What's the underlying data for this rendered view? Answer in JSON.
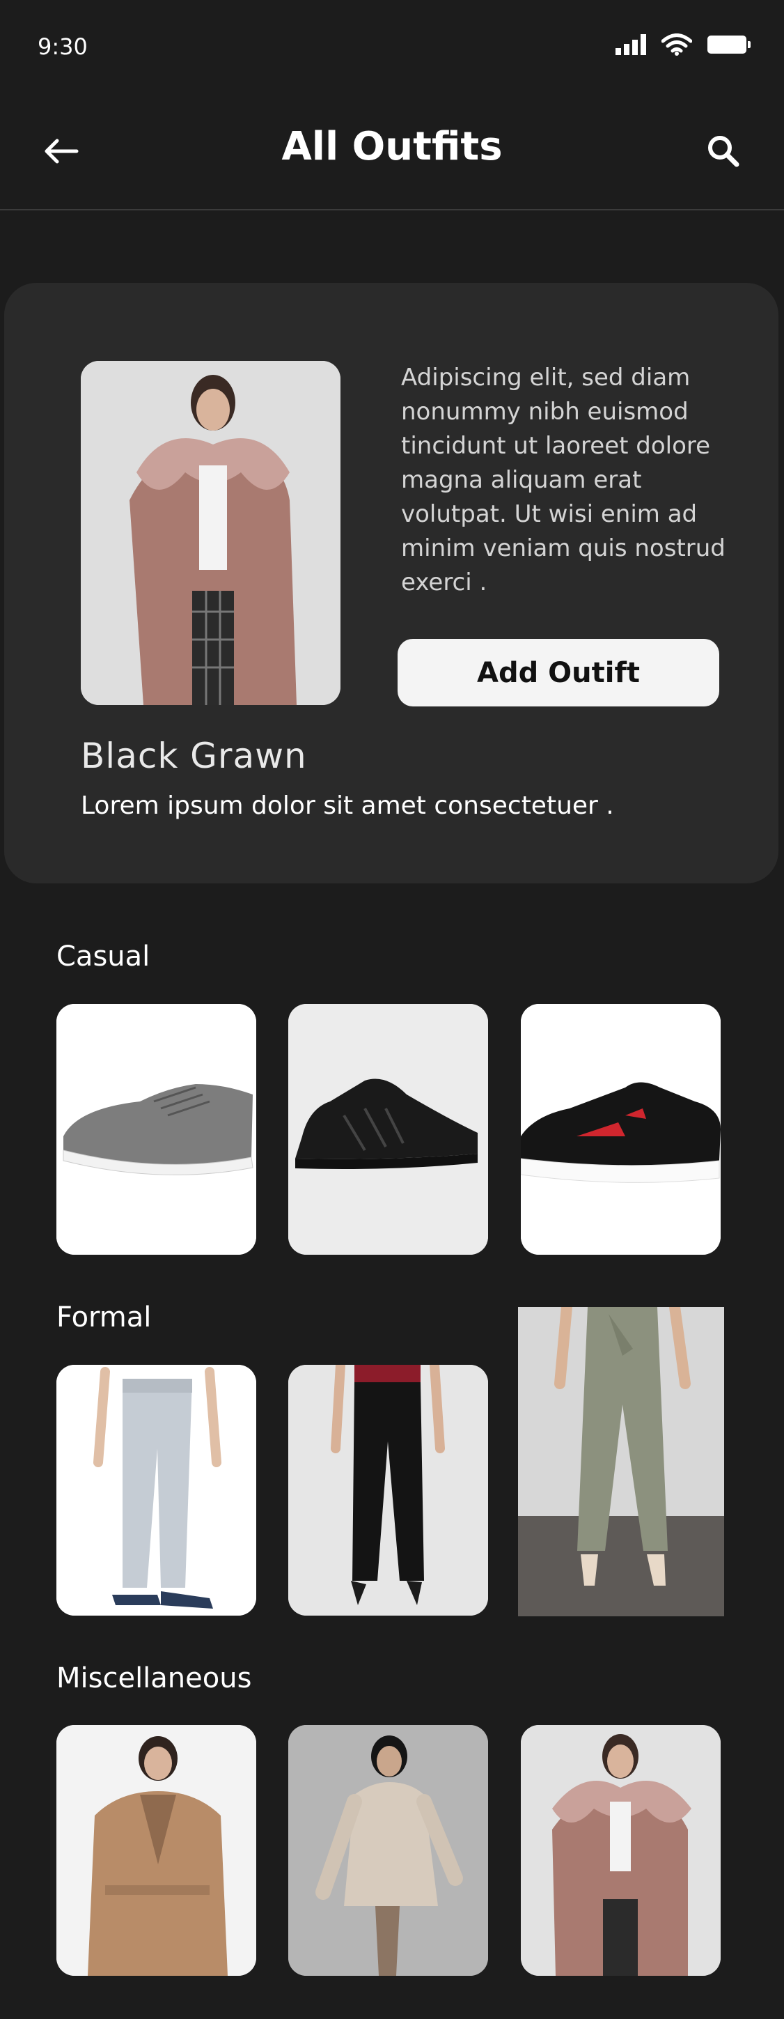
{
  "status_bar": {
    "time": "9:30"
  },
  "header": {
    "title": "All Outfits"
  },
  "hero": {
    "description": "Adipiscing elit, sed diam nonummy nibh euismod tincidunt ut laoreet dolore magna aliquam erat volutpat. Ut wisi enim ad minim veniam quis nostrud exerci  .",
    "add_button_label": "Add Outift",
    "name": "Black Grawn",
    "subtitle": "Lorem ipsum dolor sit amet consectetuer ."
  },
  "sections": [
    {
      "title": "Casual",
      "items": [
        "grey-sneaker",
        "black-knit-sneaker",
        "black-red-sneaker"
      ]
    },
    {
      "title": "Formal",
      "items": [
        "grey-joggers",
        "black-trousers",
        "olive-pants"
      ]
    },
    {
      "title": "Miscellaneous",
      "items": [
        "camel-coat",
        "beige-trench",
        "pink-puffer"
      ]
    }
  ],
  "colors": {
    "background": "#1c1c1c",
    "card": "#2a2a2a",
    "button": "#f4f4f4"
  }
}
